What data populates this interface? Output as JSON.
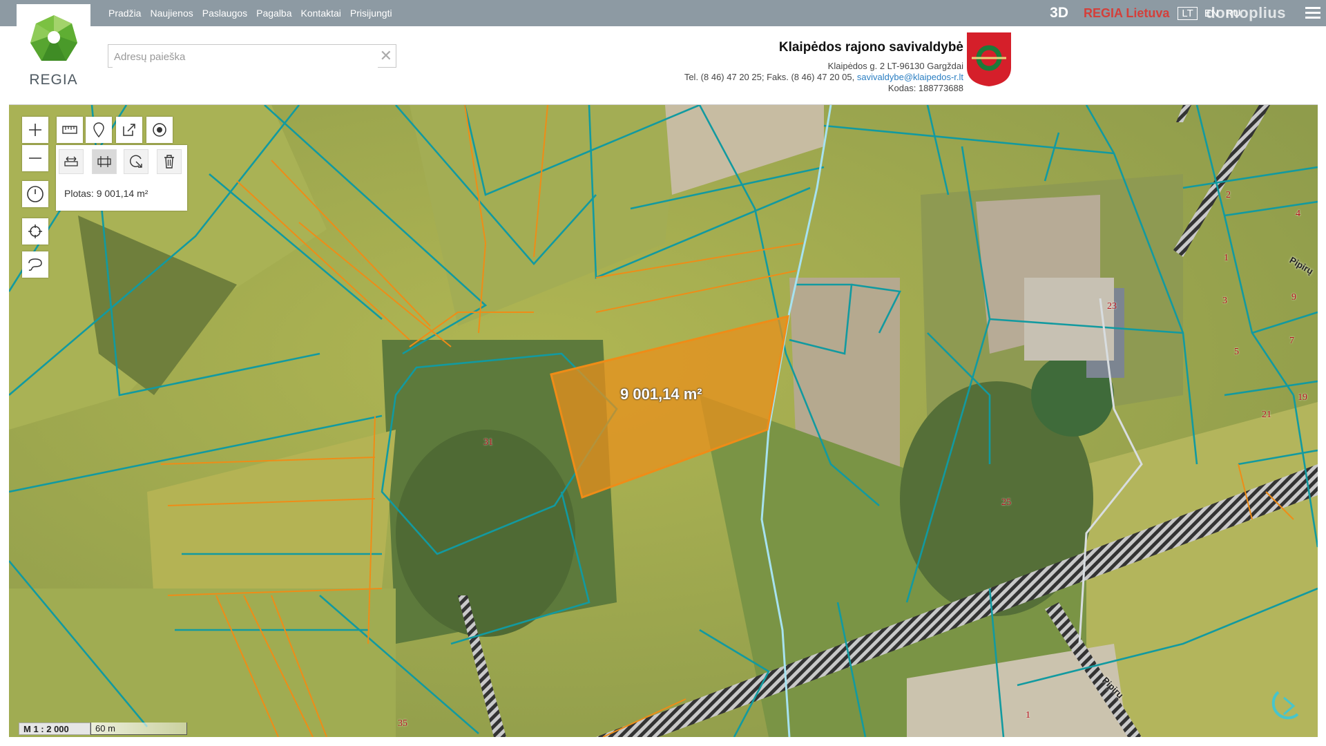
{
  "nav": {
    "items": [
      "Pradžia",
      "Naujienos",
      "Paslaugos",
      "Pagalba",
      "Kontaktai",
      "Prisijungti"
    ],
    "mode_3d": "3D",
    "regia_lietuva": "REGIA Lietuva",
    "languages": [
      "LT",
      "EN",
      "RU"
    ],
    "active_language": "LT",
    "watermark": "domoplius"
  },
  "logo": {
    "text": "REGIA"
  },
  "search": {
    "placeholder": "Adresų paieška",
    "value": "",
    "clear": "✕"
  },
  "municipality": {
    "name": "Klaipėdos rajono savivaldybė",
    "address": "Klaipėdos g. 2 LT-96130 Gargždai",
    "phones": "Tel. (8 46) 47 20 25; Faks. (8 46) 47 20 05,",
    "email": "savivaldybe@klaipedos-r.lt",
    "code": "Kodas: 188773688"
  },
  "map": {
    "area_readout": "Plotas: 9 001,14 m²",
    "parcel_label": "9 001,14 m²",
    "scale_ratio": "M 1 : 2 000",
    "scale_distance": "60 m",
    "house_numbers": [
      "31",
      "23",
      "25",
      "2",
      "4",
      "1",
      "3",
      "9",
      "5",
      "7",
      "21",
      "19",
      "35",
      "1"
    ],
    "street_labels": [
      "Pipirų",
      "Pipirų"
    ]
  },
  "colors": {
    "nav_bar": "#8d9aa3",
    "parcel_fill": "#e8901c",
    "cadastre_line": "#129aa0",
    "boundary_line": "#ef8c17",
    "brand_red": "#d43f3a"
  }
}
